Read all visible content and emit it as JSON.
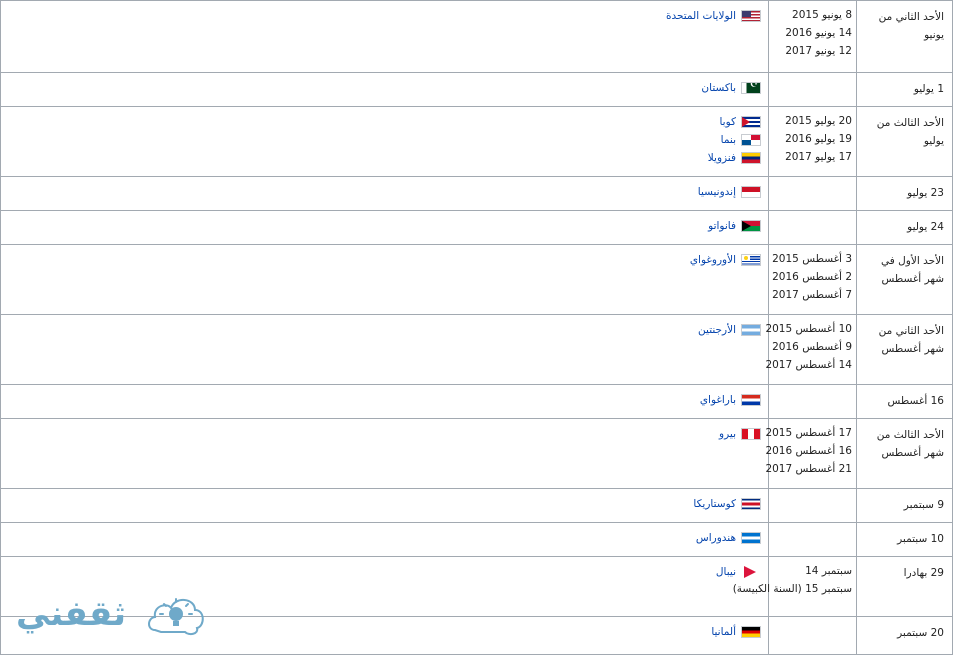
{
  "rows": [
    {
      "day": "الأحد الثاني من يونيو",
      "dates": [
        "8 يونيو 2015",
        "14 يونيو 2016",
        "12 يونيو 2017"
      ],
      "countries": [
        {
          "name": "الولايات المتحدة",
          "flag": "us-flag-icon",
          "cls": "f-us"
        }
      ]
    },
    {
      "day": "1 يوليو",
      "dates": [],
      "countries": [
        {
          "name": "باكستان",
          "flag": "pakistan-flag-icon",
          "cls": "f-pk"
        }
      ]
    },
    {
      "day": "الأحد الثالث من يوليو",
      "dates": [
        "20 يوليو 2015",
        "19 يوليو 2016",
        "17 يوليو 2017"
      ],
      "countries": [
        {
          "name": "كوبا",
          "flag": "cuba-flag-icon",
          "cls": "f-cu"
        },
        {
          "name": "بنما",
          "flag": "panama-flag-icon",
          "cls": "f-pa"
        },
        {
          "name": "فنزويلا",
          "flag": "venezuela-flag-icon",
          "cls": "f-ve"
        }
      ]
    },
    {
      "day": "23 يوليو",
      "dates": [],
      "countries": [
        {
          "name": "إندونيسيا",
          "flag": "indonesia-flag-icon",
          "cls": "f-id"
        }
      ]
    },
    {
      "day": "24 يوليو",
      "dates": [],
      "countries": [
        {
          "name": "فانواتو",
          "flag": "vanuatu-flag-icon",
          "cls": "f-vu"
        }
      ]
    },
    {
      "day": "الأحد الأول في شهر أغسطس",
      "dates": [
        "3 أغسطس 2015",
        "2 أغسطس 2016",
        "7 أغسطس 2017"
      ],
      "countries": [
        {
          "name": "الأوروغواي",
          "flag": "uruguay-flag-icon",
          "cls": "f-uy"
        }
      ]
    },
    {
      "day": "الأحد الثاني من شهر أغسطس",
      "dates": [
        "10 أغسطس 2015",
        "9 أغسطس 2016",
        "14 أغسطس 2017"
      ],
      "countries": [
        {
          "name": "الأرجنتين",
          "flag": "argentina-flag-icon",
          "cls": "f-ar"
        }
      ]
    },
    {
      "day": "16 أغسطس",
      "dates": [],
      "countries": [
        {
          "name": "باراغواي",
          "flag": "paraguay-flag-icon",
          "cls": "f-py"
        }
      ]
    },
    {
      "day": "الأحد الثالث من شهر أغسطس",
      "dates": [
        "17 أغسطس 2015",
        "16 أغسطس 2016",
        "21 أغسطس 2017"
      ],
      "countries": [
        {
          "name": "بيرو",
          "flag": "peru-flag-icon",
          "cls": "f-pe"
        }
      ]
    },
    {
      "day": "9 سبتمبر",
      "dates": [],
      "countries": [
        {
          "name": "كوستاريكا",
          "flag": "costa-rica-flag-icon",
          "cls": "f-cr"
        }
      ]
    },
    {
      "day": "10 سبتمبر",
      "dates": [],
      "countries": [
        {
          "name": "هندوراس",
          "flag": "honduras-flag-icon",
          "cls": "f-hn"
        }
      ]
    },
    {
      "day": "29 بهادرا",
      "dates": [
        "سبتمبر 14",
        "سبتمبر 15 (السنة الكبيسة)"
      ],
      "countries": [
        {
          "name": "نيبال",
          "flag": "nepal-flag-icon",
          "cls": "f-np"
        }
      ]
    },
    {
      "day": "20 سبتمبر",
      "dates": [],
      "countries": [
        {
          "name": "ألمانيا",
          "flag": "germany-flag-icon",
          "cls": "f-de"
        }
      ]
    }
  ],
  "row_heights": [
    72,
    34,
    70,
    34,
    34,
    70,
    70,
    34,
    70,
    34,
    34,
    60,
    38
  ],
  "watermark": {
    "text": "ثقفني",
    "icon": "lightbulb-icon"
  }
}
